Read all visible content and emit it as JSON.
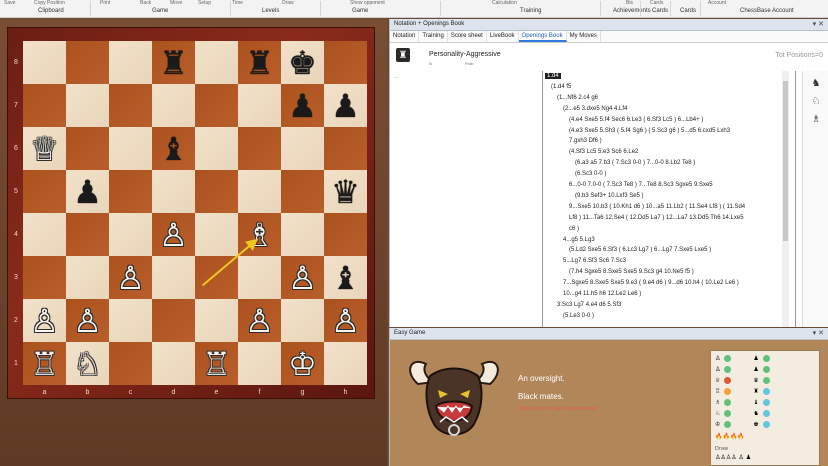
{
  "ribbon": {
    "top_items": [
      "Save",
      "Copy Position",
      "Print",
      "Back",
      "Move",
      "Setup",
      "Time",
      "Draw",
      "Show opponent",
      "Calculation",
      "Bis",
      "Cards",
      "Account"
    ],
    "groups": [
      "Clipboard",
      "Game",
      "Levels",
      "Game",
      "Training",
      "Achievements",
      "Cards",
      "Cards",
      "ChessBase Account"
    ]
  },
  "board": {
    "ranks": [
      "8",
      "7",
      "6",
      "5",
      "4",
      "3",
      "2",
      "1"
    ],
    "files": [
      "a",
      "b",
      "c",
      "d",
      "e",
      "f",
      "g",
      "h"
    ],
    "pieces": [
      {
        "sq": "d8",
        "g": "♜",
        "c": "b",
        "n": "black-rook"
      },
      {
        "sq": "f8",
        "g": "♜",
        "c": "b",
        "n": "black-rook"
      },
      {
        "sq": "g8",
        "g": "♚",
        "c": "b",
        "n": "black-king"
      },
      {
        "sq": "g7",
        "g": "♟",
        "c": "b",
        "n": "black-pawn"
      },
      {
        "sq": "h7",
        "g": "♟",
        "c": "b",
        "n": "black-pawn"
      },
      {
        "sq": "a6",
        "g": "♕",
        "c": "w",
        "n": "white-queen"
      },
      {
        "sq": "d6",
        "g": "♝",
        "c": "b",
        "n": "black-bishop"
      },
      {
        "sq": "b5",
        "g": "♟",
        "c": "b",
        "n": "black-pawn"
      },
      {
        "sq": "h5",
        "g": "♛",
        "c": "b",
        "n": "black-queen"
      },
      {
        "sq": "d4",
        "g": "♙",
        "c": "w",
        "n": "white-pawn"
      },
      {
        "sq": "f4",
        "g": "♗",
        "c": "w",
        "n": "white-bishop"
      },
      {
        "sq": "c3",
        "g": "♙",
        "c": "w",
        "n": "white-pawn"
      },
      {
        "sq": "g3",
        "g": "♙",
        "c": "w",
        "n": "white-pawn"
      },
      {
        "sq": "h3",
        "g": "♝",
        "c": "b",
        "n": "black-bishop"
      },
      {
        "sq": "a2",
        "g": "♙",
        "c": "w",
        "n": "white-pawn"
      },
      {
        "sq": "b2",
        "g": "♙",
        "c": "w",
        "n": "white-pawn"
      },
      {
        "sq": "f2",
        "g": "♙",
        "c": "w",
        "n": "white-pawn"
      },
      {
        "sq": "h2",
        "g": "♙",
        "c": "w",
        "n": "white-pawn"
      },
      {
        "sq": "a1",
        "g": "♖",
        "c": "w",
        "n": "white-rook"
      },
      {
        "sq": "b1",
        "g": "♘",
        "c": "w",
        "n": "white-knight"
      },
      {
        "sq": "e1",
        "g": "♖",
        "c": "w",
        "n": "white-rook"
      },
      {
        "sq": "g1",
        "g": "♔",
        "c": "w",
        "n": "white-king"
      }
    ],
    "arrow": {
      "from": "e3",
      "to": "f4",
      "color": "#f2c61f"
    }
  },
  "notation": {
    "title": "Notation + Openings Book",
    "tabs": [
      "Notation",
      "Training",
      "Score sheet",
      "LiveBook",
      "Openings Book",
      "My Moves"
    ],
    "active_tab": "Openings Book",
    "book_name": "Personality-Aggressive",
    "book_sub1": "N",
    "book_sub2": "Prob",
    "tot_positions": "Tot Positions=0",
    "left_col": "---",
    "tree": [
      "1.d4",
      "(1.d4 f5",
      "(1...Nf6 2.c4 g6",
      "(2...e5 3.dxe5 Ng4 4.Lf4",
      "(4.e4 Sxe5 5.f4 Sec6 6.Le3 ( 6.Sf3 Lc5 ) 6...Lb4+ )",
      "(4.e3 Sxe5 5.Sh3 ( 5.f4 Sg6 ) ( 5.Sc3 g6 ) 5...d5 6.cxd5 Lxh3",
      "7.gxh3 Df6 )",
      "(4.Sf3 Lc5 5.e3 Sc6 6.Le2",
      "(6.a3 a5 7.b3 ( 7.Sc3 0-0 ) 7...0-0 8.Lb2 Te8 )",
      "(6.Sc3 0-0 )",
      "6...0-0 7.0-0 ( 7.Sc3 Te8 ) 7...Te8 8.Sc3 Sgxe5 9.Sxe5",
      "(9.b3 Sef3+ 10.Lxf3 Se5 )",
      "9...Sxe5 10.b3 ( 10.Kh1 d6 ) 10...a5 11.Lb2 ( 11.Se4 Lf8 ) ( 11.Sd4",
      "Lf8 ) 11...Ta6 12.Se4 ( 12.Dd5 La7 ) 12...La7 13.Dd5 Th6 14.Lxe5",
      "c6 )",
      "4...g5 5.Lg3",
      "(5.Ld2 Sxe5 6.Sf3 ( 6.Lc3 Lg7 ) 6...Lg7 7.Sxe5 Lxe5 )",
      "5...Lg7 6.Sf3 Sc6 7.Sc3",
      "(7.h4 Sgxe5 8.Sxe5 Sxe5 9.Sc3 g4 10.Ne5 f5 )",
      "7...Sgxe5 8.Sxe5 Sxe5 9.e3 ( 9.e4 d6 ) 9...d6 10.h4 ( 10.Le2 Le6 )",
      "10...g4 11.h5 h6 12.Le2 Le6 )",
      "3.Sc3 Lg7 4.e4 d6 5.Sf3",
      "(5.Le3 0-0 )"
    ]
  },
  "easy": {
    "title": "Easy Game",
    "msg1": "An oversight.",
    "msg2": "Black mates.",
    "msg3": "Please log in to earn achievements!",
    "stats_rows": [
      {
        "wp": "♙",
        "wd": "g",
        "bp": "♟",
        "bd": "g"
      },
      {
        "wp": "♙",
        "wd": "g",
        "bp": "♟",
        "bd": "g"
      },
      {
        "wp": "♕",
        "wd": "r",
        "bp": "♛",
        "bd": "g"
      },
      {
        "wp": "♖",
        "wd": "o",
        "bp": "♜",
        "bd": "c"
      },
      {
        "wp": "♗",
        "wd": "g",
        "bp": "♝",
        "bd": "c"
      },
      {
        "wp": "♘",
        "wd": "g",
        "bp": "♞",
        "bd": "c"
      },
      {
        "wp": "♔",
        "wd": "g",
        "bp": "♚",
        "bd": "c"
      }
    ],
    "draw_label": "Draw",
    "pawns_row": "♙♙♙♙ ♙ ♟"
  }
}
